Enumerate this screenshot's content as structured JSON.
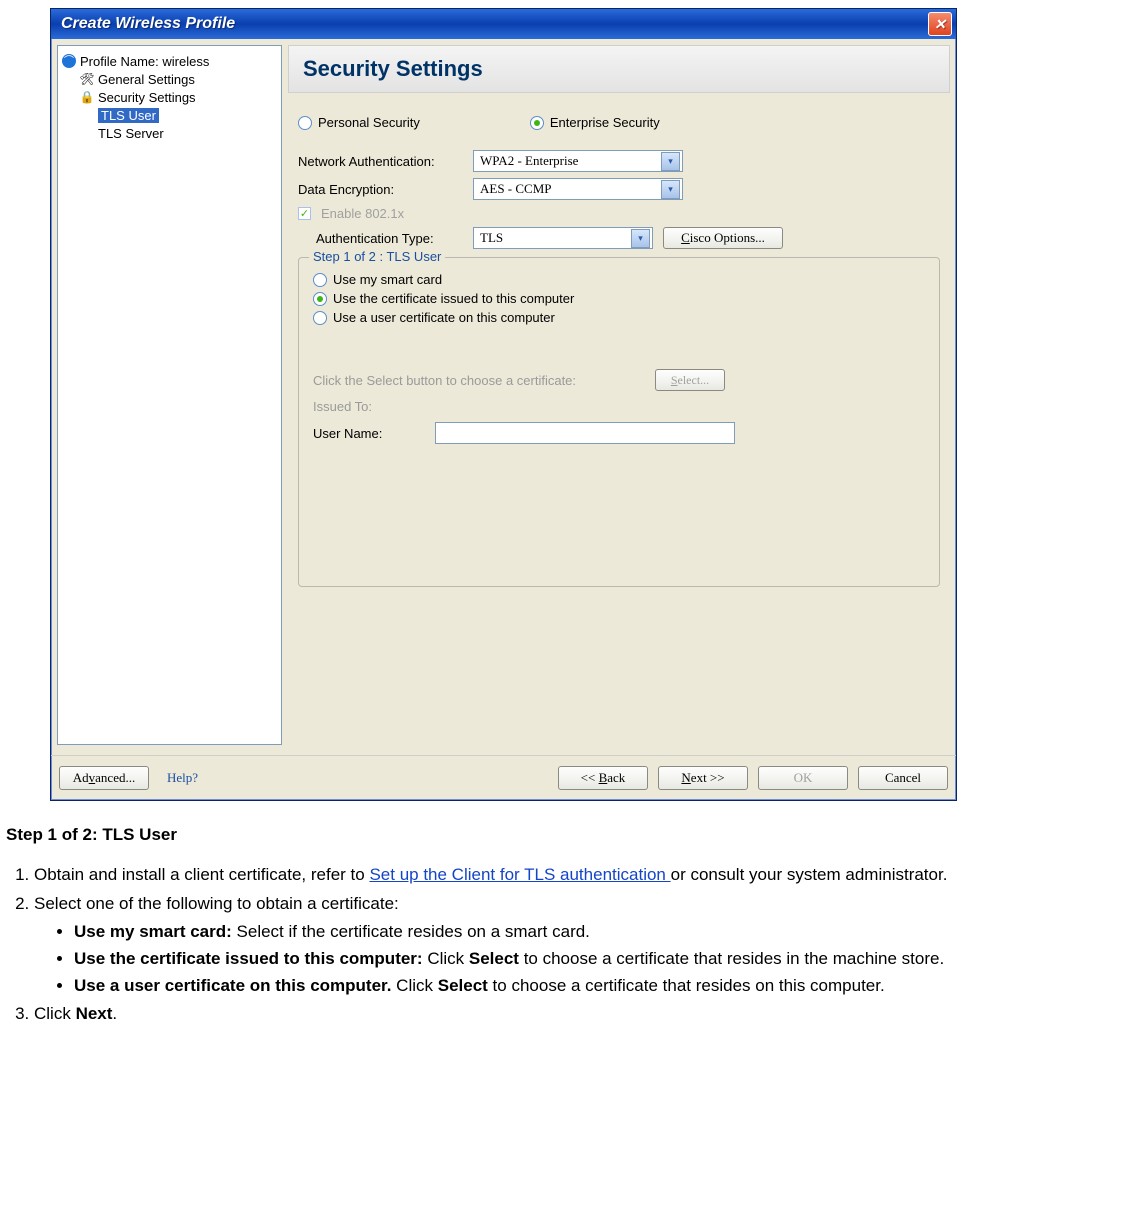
{
  "window": {
    "title": "Create Wireless Profile"
  },
  "tree": {
    "items": [
      {
        "label": "Profile Name: wireless",
        "icon": "wifi"
      },
      {
        "label": "General Settings",
        "icon": "gear"
      },
      {
        "label": "Security Settings",
        "icon": "lock"
      },
      {
        "label": "TLS User",
        "selected": true
      },
      {
        "label": "TLS Server"
      }
    ]
  },
  "header": {
    "title": "Security Settings"
  },
  "security_mode": {
    "personal_label": "Personal Security",
    "enterprise_label": "Enterprise Security",
    "selected": "enterprise"
  },
  "fields": {
    "net_auth_label": "Network Authentication:",
    "net_auth_value": "WPA2 - Enterprise",
    "data_enc_label": "Data Encryption:",
    "data_enc_value": "AES - CCMP",
    "enable_8021x_label": "Enable 802.1x",
    "auth_type_label": "Authentication Type:",
    "auth_type_value": "TLS",
    "cisco_button": "Cisco Options..."
  },
  "fieldset": {
    "legend": "Step 1 of 2 : TLS User",
    "opt1": "Use my smart card",
    "opt2": "Use the certificate issued to this computer",
    "opt3": "Use a user certificate on this computer",
    "select_prompt": "Click the Select button to choose a certificate:",
    "select_button": "Select...",
    "issued_to_label": "Issued To:",
    "user_name_label": "User Name:"
  },
  "footer": {
    "advanced": "Advanced...",
    "help": "Help?",
    "back": "<< Back",
    "next": "Next >>",
    "ok": "OK",
    "cancel": "Cancel"
  },
  "doc": {
    "heading": "Step 1 of 2: TLS User",
    "li1_a": "Obtain and install a client certificate, refer to ",
    "li1_link": "Set up the Client for TLS authentication ",
    "li1_b": "or consult your system administrator.",
    "li2": "Select one of the following to obtain a certificate:",
    "b1_t": "Use my smart card:",
    "b1_r": " Select if the certificate resides on a smart card.",
    "b2_t": "Use the certificate issued to this computer:",
    "b2_r": " Click ",
    "b2_s": "Select",
    "b2_r2": " to choose a certificate that resides in the machine store.",
    "b3_t": "Use a user certificate on this computer.",
    "b3_r": " Click ",
    "b3_s": "Select",
    "b3_r2": " to choose a certificate that resides on this computer.",
    "li3_a": "Click ",
    "li3_b": "Next",
    "li3_c": "."
  }
}
